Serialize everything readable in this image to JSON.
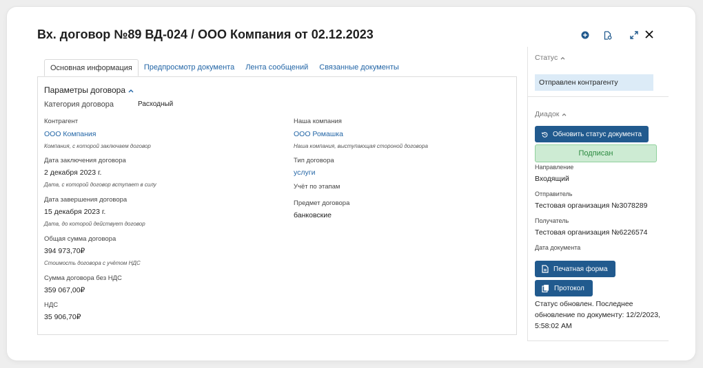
{
  "header": {
    "title": "Вх. договор №89 ВД-024 / ООО Компания от 02.12.2023",
    "icons": [
      "add-circle-icon",
      "document-settings-icon",
      "expand-icon",
      "close-icon"
    ]
  },
  "tabs": [
    {
      "label": "Основная информация",
      "active": true
    },
    {
      "label": "Предпросмотр документа",
      "active": false
    },
    {
      "label": "Лента сообщений",
      "active": false
    },
    {
      "label": "Связанные документы",
      "active": false
    }
  ],
  "params": {
    "title": "Параметры договора",
    "category_label": "Категория договора",
    "category_value": "Расходный",
    "left": [
      {
        "label": "Контрагент",
        "value": "ООО Компания",
        "hint": "Компания, с которой заключаем договор"
      },
      {
        "label": "Дата заключения договора",
        "value": "2 декабря 2023 г.",
        "hint": "Дата, с которой договор вступает в силу"
      },
      {
        "label": "Дата завершения договора",
        "value": "15 декабря 2023 г.",
        "hint": "Дата, до которой действует договор"
      },
      {
        "label": "Общая сумма договора",
        "value": "394 973,70₽",
        "hint": "Стоимость договора с учётом НДС"
      },
      {
        "label": "Сумма договора без НДС",
        "value": "359 067,00₽"
      },
      {
        "label": "НДС",
        "value": "35 906,70₽"
      }
    ],
    "right": [
      {
        "label": "Наша компания",
        "value": "ООО Ромашка",
        "hint": "Наша компания, выступающая стороной договора"
      },
      {
        "label": "Тип договора",
        "value": "услуги"
      },
      {
        "label": "Учёт по этапам"
      },
      {
        "label": "Предмет договора",
        "value": "банковские"
      }
    ]
  },
  "sidebar": {
    "status_title": "Статус",
    "status_value": "Отправлен контрагенту",
    "diadoc_title": "Диадок",
    "refresh_button": "Обновить статус документа",
    "signed_badge": "Подписан",
    "direction_label": "Направление",
    "direction_value": "Входящий",
    "sender_label": "Отправитель",
    "sender_value": "Тестовая организация №3078289",
    "recipient_label": "Получатель",
    "recipient_value": "Тестовая организация №6226574",
    "doc_date_label": "Дата документа",
    "print_button": "Печатная форма",
    "protocol_button": "Протокол",
    "status_note": "Статус обновлен. Последнее обновление по документу: 12/2/2023, 5:58:02 AM"
  },
  "colors": {
    "primary_button": "#215a8e",
    "link": "#2265a6",
    "status_box": "#dcebf7",
    "signed_bg": "#cdebd3",
    "signed_text": "#2c8a40"
  }
}
